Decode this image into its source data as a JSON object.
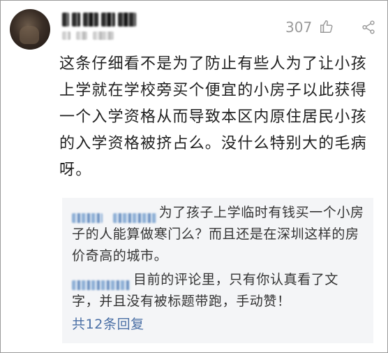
{
  "comment": {
    "like_count": "307",
    "icons": {
      "like": "thumbs-up-icon",
      "share": "share-icon"
    },
    "text": "这条仔细看不是为了防止有些人为了让小孩上学就在学校旁买个便宜的小房子以此获得一个入学资格从而导致本区内原住居民小孩的入学资格被挤占么。没什么特别大的毛病呀。"
  },
  "replies": {
    "items": [
      {
        "text": "为了孩子上学临时有钱买一个小房子的人能算做寒门么？而且还是在深圳这样的房价奇高的城市。"
      },
      {
        "text": "目前的评论里，只有你认真看了文字，并且没有被标题带跑，手动赞！"
      }
    ],
    "more_label": "共12条回复"
  },
  "colors": {
    "link": "#4a6fa5",
    "reply_background": "#f4f5f7",
    "muted": "#9a9a9a"
  }
}
